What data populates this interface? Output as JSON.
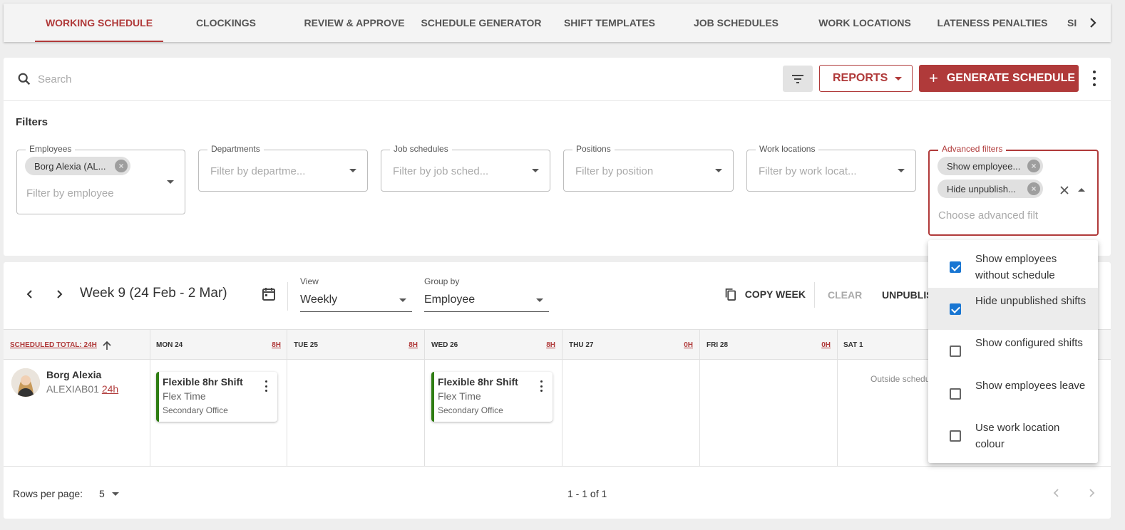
{
  "tabs": [
    {
      "label": "WORKING SCHEDULE",
      "active": true
    },
    {
      "label": "CLOCKINGS"
    },
    {
      "label": "REVIEW & APPROVE"
    },
    {
      "label": "SCHEDULE GENERATOR"
    },
    {
      "label": "SHIFT TEMPLATES"
    },
    {
      "label": "JOB SCHEDULES"
    },
    {
      "label": "WORK LOCATIONS"
    },
    {
      "label": "LATENESS PENALTIES"
    },
    {
      "label": "SI"
    }
  ],
  "toolbar": {
    "search_placeholder": "Search",
    "reports_label": "REPORTS",
    "generate_label": "GENERATE SCHEDULE",
    "generate_icon": "+"
  },
  "filters": {
    "title": "Filters",
    "employees": {
      "label": "Employees",
      "chip": "Borg Alexia (AL...",
      "placeholder": "Filter by employee"
    },
    "departments": {
      "label": "Departments",
      "placeholder": "Filter by departme..."
    },
    "job_schedules": {
      "label": "Job schedules",
      "placeholder": "Filter by job sched..."
    },
    "positions": {
      "label": "Positions",
      "placeholder": "Filter by position"
    },
    "work_locations": {
      "label": "Work locations",
      "placeholder": "Filter by work locat..."
    },
    "advanced": {
      "label": "Advanced filters",
      "chips": [
        "Show employee...",
        "Hide unpublish..."
      ],
      "placeholder": "Choose advanced filt"
    }
  },
  "schedule": {
    "week_label": "Week 9 (24 Feb - 2 Mar)",
    "view": {
      "label": "View",
      "value": "Weekly"
    },
    "group_by": {
      "label": "Group by",
      "value": "Employee"
    },
    "copy_week": "COPY WEEK",
    "clear": "CLEAR",
    "unpublish": "UNPUBLIS",
    "total_header": "SCHEDULED TOTAL: 24H",
    "days": [
      {
        "label": "MON 24",
        "hours": "8H"
      },
      {
        "label": "TUE 25",
        "hours": "8H"
      },
      {
        "label": "WED 26",
        "hours": "8H"
      },
      {
        "label": "THU 27",
        "hours": "0H"
      },
      {
        "label": "FRI 28",
        "hours": "0H"
      },
      {
        "label": "SAT 1",
        "hours": ""
      }
    ],
    "employee": {
      "name": "Borg Alexia",
      "code": "ALEXIAB01",
      "hours": "24h"
    },
    "shifts": [
      {
        "title": "Flexible 8hr Shift",
        "type": "Flex Time",
        "location": "Secondary Office"
      },
      {
        "title": "Flexible 8hr Shift",
        "type": "Flex Time",
        "location": "Secondary Office"
      }
    ],
    "outside_text": "Outside schedu"
  },
  "footer": {
    "rows_label": "Rows per page:",
    "rows_value": "5",
    "range": "1 - 1 of 1"
  },
  "advanced_options": [
    {
      "label": "Show employees without schedule",
      "checked": true
    },
    {
      "label": "Hide unpublished shifts",
      "checked": true
    },
    {
      "label": "Show configured shifts",
      "checked": false
    },
    {
      "label": "Show employees leave",
      "checked": false
    },
    {
      "label": "Use work location colour",
      "checked": false
    }
  ],
  "colors": {
    "accent": "#b03a3a",
    "checkbox": "#1976d2",
    "shift_border": "#2e7d12"
  }
}
